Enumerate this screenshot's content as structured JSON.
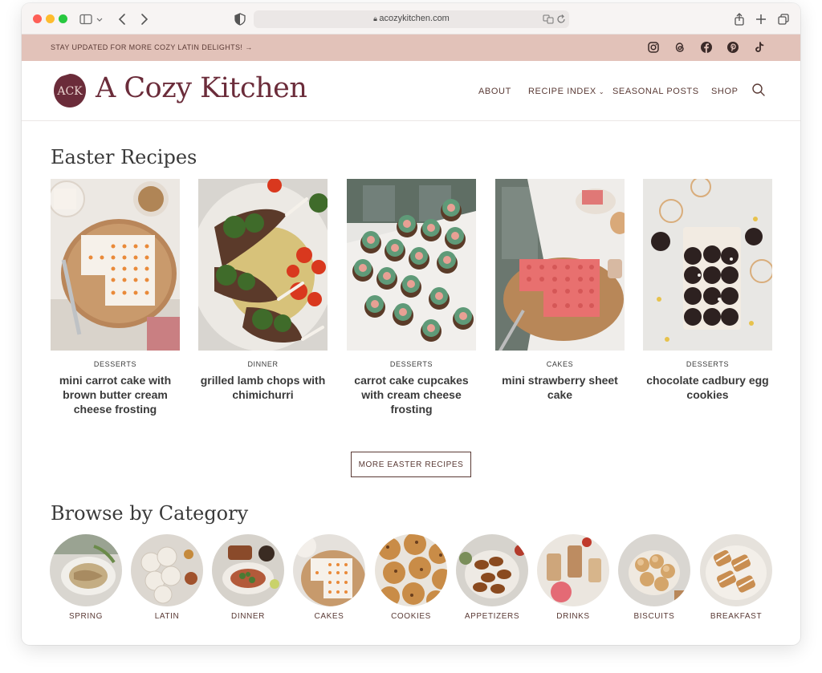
{
  "browser": {
    "url": "acozykitchen.com"
  },
  "announcement": {
    "text": "STAY UPDATED FOR MORE COZY LATIN DELIGHTS! →",
    "social_icons": [
      "instagram-icon",
      "threads-icon",
      "facebook-icon",
      "pinterest-icon",
      "tiktok-icon"
    ]
  },
  "header": {
    "site_name": "A Cozy Kitchen",
    "nav": [
      {
        "label": "ABOUT"
      },
      {
        "label": "RECIPE INDEX"
      },
      {
        "label": "SEASONAL POSTS"
      },
      {
        "label": "SHOP"
      }
    ],
    "nav_dropdown_indicator": "⌄"
  },
  "easter": {
    "title": "Easter Recipes",
    "cards": [
      {
        "category": "DESSERTS",
        "title": "mini carrot cake with brown butter cream cheese frosting"
      },
      {
        "category": "DINNER",
        "title": "grilled lamb chops with chimichurri"
      },
      {
        "category": "DESSERTS",
        "title": "carrot cake cupcakes with cream cheese frosting"
      },
      {
        "category": "CAKES",
        "title": "mini strawberry sheet cake"
      },
      {
        "category": "DESSERTS",
        "title": "chocolate cadbury egg cookies"
      }
    ],
    "more_button": "MORE EASTER RECIPES"
  },
  "browse": {
    "title": "Browse by Category",
    "categories": [
      {
        "label": "SPRING"
      },
      {
        "label": "LATIN"
      },
      {
        "label": "DINNER"
      },
      {
        "label": "CAKES"
      },
      {
        "label": "COOKIES"
      },
      {
        "label": "APPETIZERS"
      },
      {
        "label": "DRINKS"
      },
      {
        "label": "BISCUITS"
      },
      {
        "label": "BREAKFAST"
      }
    ]
  },
  "colors": {
    "brand": "#6b2c3a",
    "announce_bg": "#e2c2b9",
    "text_dark": "#3a3a3a",
    "nav_text": "#5a3a35"
  }
}
